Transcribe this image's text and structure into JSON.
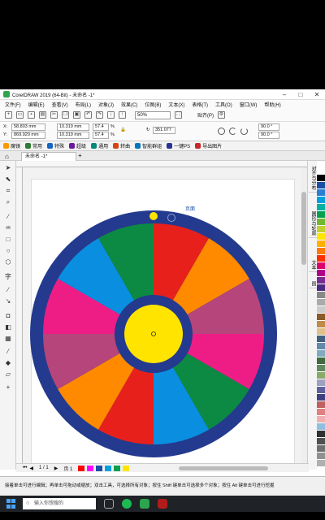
{
  "window": {
    "title": "CorelDRAW 2019 (64-Bit) - 未命名 -1*"
  },
  "menu": [
    "文件(F)",
    "编辑(E)",
    "查看(V)",
    "布局(L)",
    "对象(J)",
    "效果(C)",
    "位图(B)",
    "文本(X)",
    "表格(T)",
    "工具(O)",
    "窗口(W)",
    "帮助(H)"
  ],
  "toolbar": {
    "zoom": "50%",
    "snap_label": "贴齐(P)"
  },
  "props": {
    "x": "58.803 mm",
    "y": "869.929 mm",
    "w": "10.319 mm",
    "h": "10.319 mm",
    "sx": "57.4",
    "sy": "57.4",
    "pct": "%",
    "rotation": "351.077",
    "start_angle": "90.0 °",
    "end_angle": "90.0 °"
  },
  "plugins": [
    "魔镜",
    "常用",
    "特殊",
    "超级",
    "通用",
    "转曲",
    "智能群组",
    "一键PS",
    "导出图片"
  ],
  "tab": {
    "name": "未命名 -1*"
  },
  "docker_tabs": [
    "对齐与分布",
    "圆形与轮廓",
    "文本",
    "图"
  ],
  "bottom": {
    "page_label": "页 1",
    "page_counter": "1 / 1"
  },
  "status": {
    "hint": "接着单击可进行编辑；再单击可拖动或缩放；双击工具，可选择所有对象；按住 Shift 键单击可选择多个对象；按住 Alt 键单击可进行挖掘"
  },
  "taskbar": {
    "search_placeholder": "输入你想搜的"
  },
  "wheel": {
    "segment_colors": [
      "#e8201c",
      "#ff8a00",
      "#b5457b",
      "#ee1d86",
      "#0c8a43",
      "#0a8fe0",
      "#e8201c",
      "#ff8a00",
      "#b5457b",
      "#ee1d86",
      "#0a8fe0",
      "#0c8a43"
    ],
    "ring_color": "#243a8e",
    "hub_color": "#ffe400",
    "marker_color": "#ffe400",
    "cursor_label": "页面"
  },
  "palette_colors": [
    "#ffffff",
    "#000000",
    "#1a4fa8",
    "#2a7fd4",
    "#00a0e0",
    "#00b0a0",
    "#00a050",
    "#70b830",
    "#c0d030",
    "#ffe400",
    "#ffb000",
    "#ff7a00",
    "#ff3000",
    "#e0006a",
    "#b0008a",
    "#7a2a90",
    "#4a2a80",
    "#888888",
    "#aaaaaa",
    "#cccccc",
    "#8a5a2a",
    "#c08a4a",
    "#e0c08a",
    "#406080",
    "#608aaa",
    "#80aac0",
    "#406a40",
    "#608a60",
    "#8aaa6a",
    "#a0a0c0",
    "#6060a0",
    "#404080",
    "#c06060",
    "#e08080",
    "#f0b0b0",
    "#90c0e0",
    "#303030",
    "#505050",
    "#707070",
    "#909090",
    "#b0b0b0"
  ]
}
